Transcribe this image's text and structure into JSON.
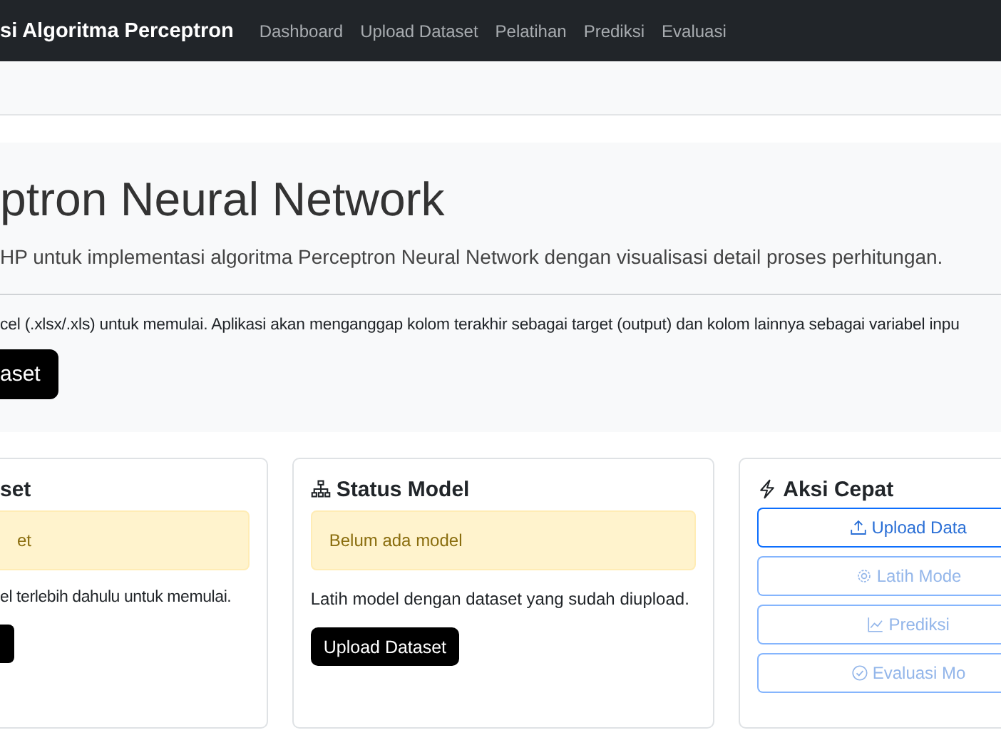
{
  "navbar": {
    "brand": "si Algoritma Perceptron",
    "links": [
      {
        "label": "Dashboard"
      },
      {
        "label": "Upload Dataset"
      },
      {
        "label": "Pelatihan"
      },
      {
        "label": "Prediksi"
      },
      {
        "label": "Evaluasi"
      }
    ]
  },
  "hero": {
    "title": "ptron Neural Network",
    "lead": "HP untuk implementasi algoritma Perceptron Neural Network dengan visualisasi detail proses perhitungan.",
    "text": "cel (.xlsx/.xls) untuk memulai. Aplikasi akan menganggap kolom terakhir sebagai target (output) dan kolom lainnya sebagai variabel inpu",
    "button": "aset"
  },
  "cards": [
    {
      "kind": "status",
      "title": "set",
      "alert": "et",
      "text": "el terlebih dahulu untuk memulai."
    },
    {
      "kind": "status",
      "title": "Status Model",
      "alert": "Belum ada model",
      "text": "Latih model dengan dataset yang sudah diupload.",
      "button": "Upload Dataset"
    },
    {
      "kind": "actions",
      "title": "Aksi Cepat",
      "actions": [
        {
          "label": "Upload Data",
          "disabled": false
        },
        {
          "label": "Latih Mode",
          "disabled": true
        },
        {
          "label": "Prediksi",
          "disabled": true
        },
        {
          "label": "Evaluasi Mo",
          "disabled": true
        }
      ]
    }
  ]
}
